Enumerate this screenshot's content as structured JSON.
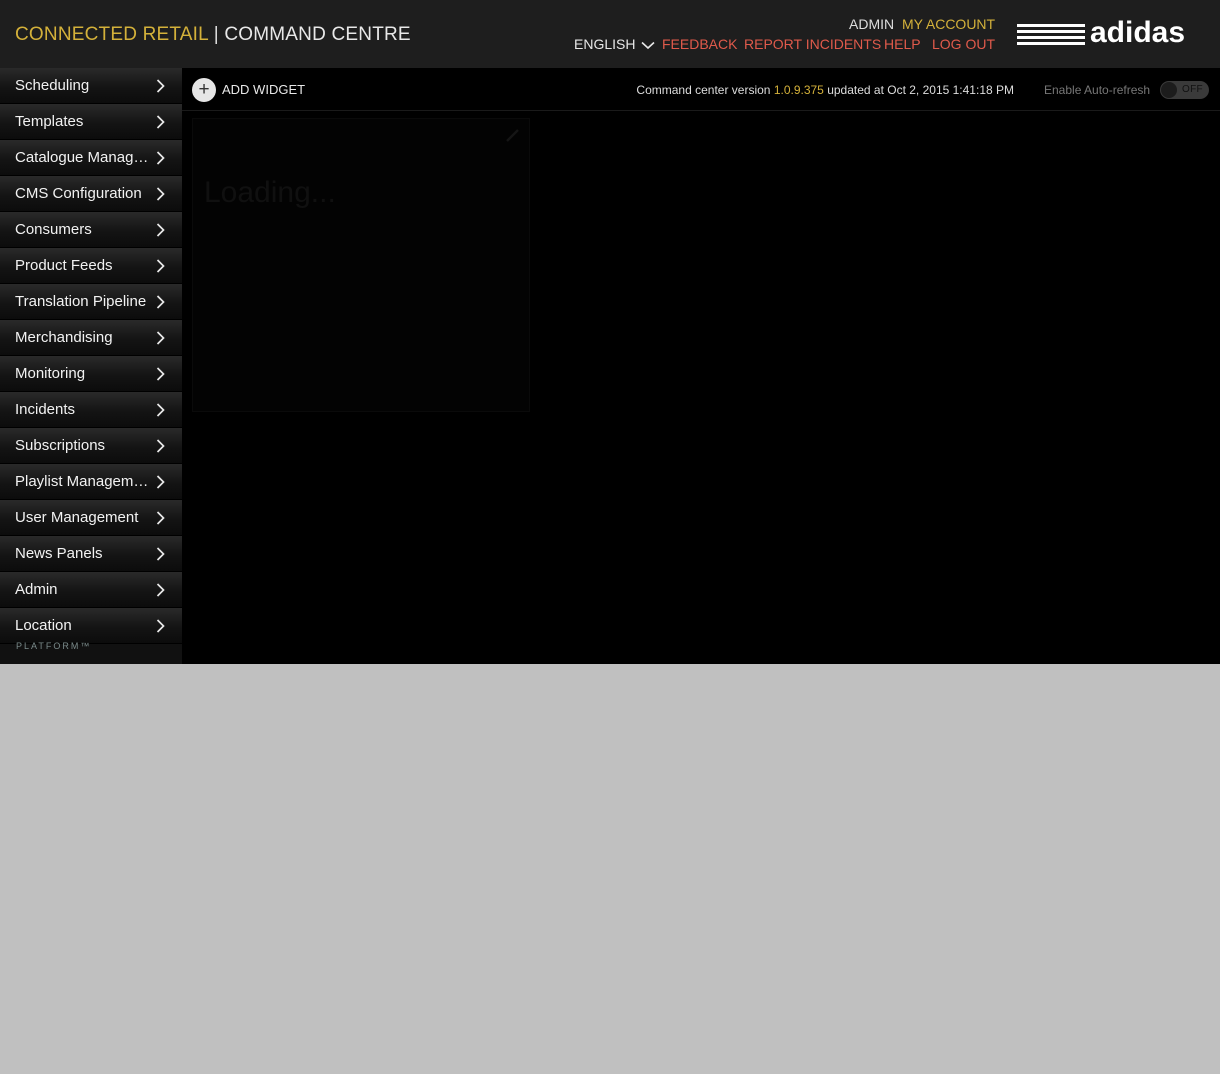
{
  "header": {
    "brand_accent": "CONNECTED RETAIL",
    "brand_separator": "|",
    "brand_rest": "COMMAND CENTRE",
    "user": "ADMIN",
    "my_account": "MY ACCOUNT",
    "language": "ENGLISH",
    "feedback": "FEEDBACK",
    "report_incidents": "REPORT INCIDENTS",
    "help": "HELP",
    "log_out": "LOG OUT",
    "logo_text": "adidas"
  },
  "sidebar": {
    "items": [
      {
        "label": "Scheduling"
      },
      {
        "label": "Templates"
      },
      {
        "label": "Catalogue Management"
      },
      {
        "label": "CMS Configuration"
      },
      {
        "label": "Consumers"
      },
      {
        "label": "Product Feeds"
      },
      {
        "label": "Translation Pipeline"
      },
      {
        "label": "Merchandising"
      },
      {
        "label": "Monitoring"
      },
      {
        "label": "Incidents"
      },
      {
        "label": "Subscriptions"
      },
      {
        "label": "Playlist Management"
      },
      {
        "label": "User Management"
      },
      {
        "label": "News Panels"
      },
      {
        "label": "Admin"
      },
      {
        "label": "Location"
      }
    ],
    "footer_text": "PLATFORM™"
  },
  "toolbar": {
    "add_widget": "ADD WIDGET",
    "version_prefix": "Command center version",
    "version": "1.0.9.375",
    "version_suffix": "updated at Oct 2, 2015 1:41:18 PM",
    "auto_refresh_label": "Enable Auto-refresh",
    "auto_refresh_state": "OFF"
  },
  "widget": {
    "title": "",
    "loading_text": "Loading..."
  },
  "colors": {
    "accent": "#d4b13a",
    "link_red": "#e05a4b",
    "header_bg": "#1e1e1e",
    "app_bg": "#000000",
    "page_bg": "#c0c0c0"
  },
  "icons": {
    "nav_chevron": "chevron-right-icon",
    "language_chevron": "chevron-down-icon",
    "add_widget": "plus-circle-icon",
    "widget_edit": "pencil-icon"
  }
}
